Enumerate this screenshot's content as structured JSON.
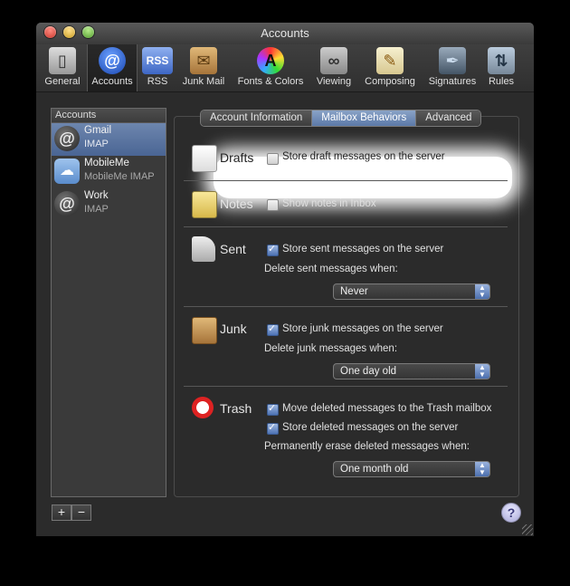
{
  "window": {
    "title": "Accounts"
  },
  "toolbar": {
    "items": [
      {
        "label": "General",
        "icon": "switch-icon"
      },
      {
        "label": "Accounts",
        "icon": "at-sign-icon"
      },
      {
        "label": "RSS",
        "icon": "rss-icon"
      },
      {
        "label": "Junk Mail",
        "icon": "junk-bag-icon"
      },
      {
        "label": "Fonts & Colors",
        "icon": "fonts-colors-icon"
      },
      {
        "label": "Viewing",
        "icon": "glasses-icon"
      },
      {
        "label": "Composing",
        "icon": "pencil-paper-icon"
      },
      {
        "label": "Signatures",
        "icon": "pen-icon"
      },
      {
        "label": "Rules",
        "icon": "rules-icon"
      }
    ],
    "selected": "Accounts"
  },
  "sidebar": {
    "header": "Accounts",
    "accounts": [
      {
        "name": "Gmail",
        "type": "IMAP",
        "selected": true
      },
      {
        "name": "MobileMe",
        "type": "MobileMe IMAP",
        "selected": false
      },
      {
        "name": "Work",
        "type": "IMAP",
        "selected": false
      }
    ],
    "add_label": "+",
    "remove_label": "−"
  },
  "tabs": [
    {
      "label": "Account Information",
      "active": false
    },
    {
      "label": "Mailbox Behaviors",
      "active": true
    },
    {
      "label": "Advanced",
      "active": false
    }
  ],
  "sections": {
    "drafts": {
      "title": "Drafts",
      "store_label": "Store draft messages on the server",
      "store_checked": false
    },
    "notes": {
      "title": "Notes",
      "show_label": "Show notes in Inbox",
      "show_checked": false
    },
    "sent": {
      "title": "Sent",
      "store_label": "Store sent messages on the server",
      "store_checked": true,
      "delete_label": "Delete sent messages when:",
      "delete_value": "Never"
    },
    "junk": {
      "title": "Junk",
      "store_label": "Store junk messages on the server",
      "store_checked": true,
      "delete_label": "Delete junk messages when:",
      "delete_value": "One day old"
    },
    "trash": {
      "title": "Trash",
      "move_label": "Move deleted messages to the Trash mailbox",
      "move_checked": true,
      "store_label": "Store deleted messages on the server",
      "store_checked": true,
      "erase_label": "Permanently erase deleted messages when:",
      "erase_value": "One month old"
    }
  },
  "help_label": "?",
  "colors": {
    "selection": "#5b79a8",
    "background": "#2b2b2b"
  }
}
